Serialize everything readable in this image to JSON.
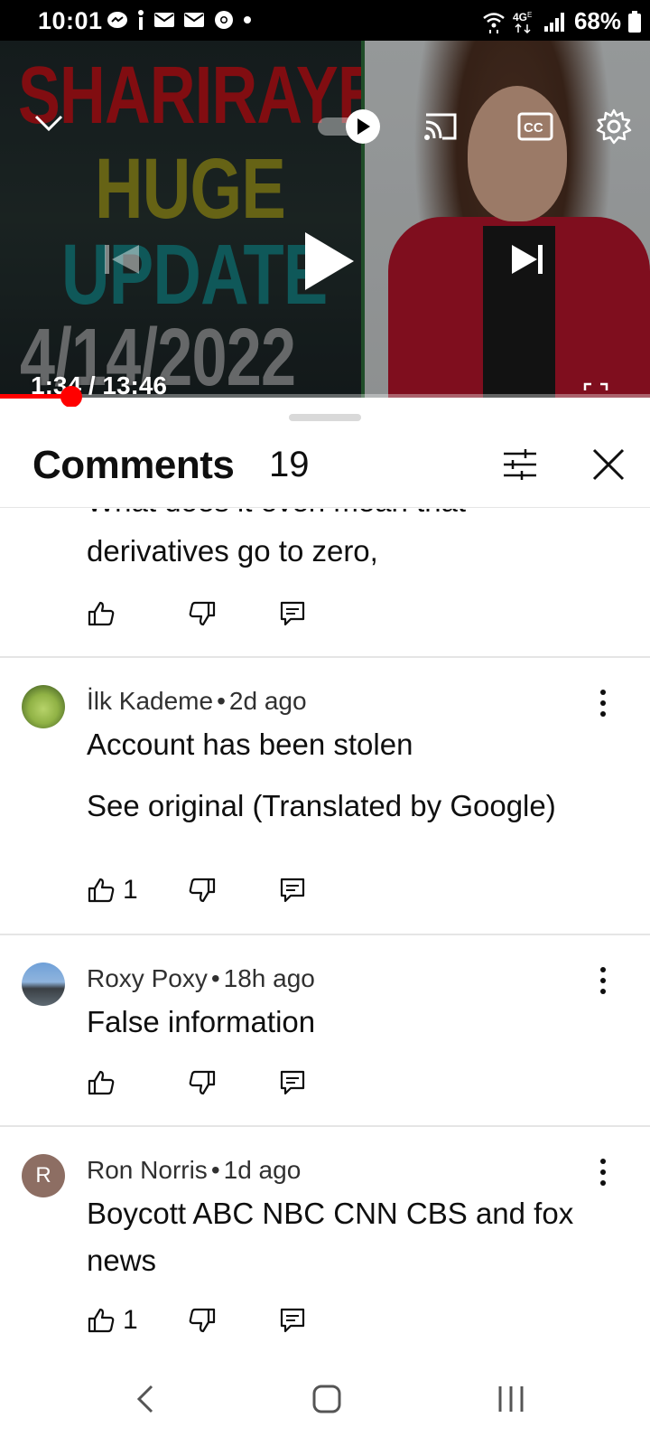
{
  "status_bar": {
    "time": "10:01",
    "battery": "68%",
    "icons": [
      "messenger-icon",
      "info-icon",
      "mail-icon",
      "mail-icon",
      "chrome-icon",
      "dot-icon",
      "wifi-icon",
      "4g-icon",
      "signal-icon",
      "battery-icon"
    ]
  },
  "player": {
    "thumbnail_text": [
      "SHARIRAYE",
      "HUGE",
      "UPDATE",
      "4/14/2022"
    ],
    "time_display": "1:34 / 13:46",
    "progress_fraction": 0.11,
    "autoplay": true
  },
  "comments_panel": {
    "title": "Comments",
    "count": "19"
  },
  "comments": [
    {
      "partial_text_line1": "What does it even mean that",
      "partial_text_line2": "derivatives go to zero,",
      "likes": ""
    },
    {
      "author": "İlk Kademe",
      "time": "2d ago",
      "text": "Account has been stolen",
      "translate": "See original (Translated by Google)",
      "likes": "1"
    },
    {
      "author": "Roxy Poxy",
      "time": "18h ago",
      "text": "False information",
      "likes": ""
    },
    {
      "author": "Ron Norris",
      "time": "1d ago",
      "text": "Boycott ABC NBC CNN CBS and fox news",
      "avatar_letter": "R",
      "likes": "1"
    }
  ],
  "colors": {
    "progress": "#ff0000",
    "avatar_r": "#8d6e63"
  }
}
